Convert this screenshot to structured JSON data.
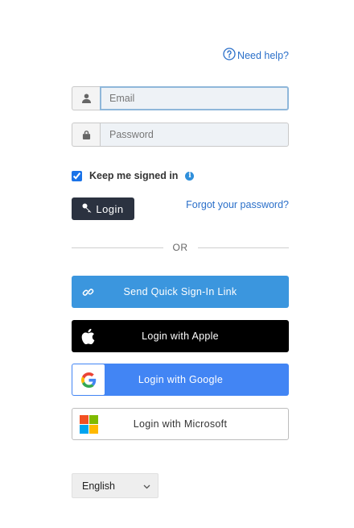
{
  "help": {
    "label": "Need help?",
    "icon": "help-circle-icon",
    "color": "#2a6fc9"
  },
  "email": {
    "value": "",
    "placeholder": "Email",
    "icon": "user-icon"
  },
  "password": {
    "value": "",
    "placeholder": "Password",
    "icon": "lock-icon"
  },
  "remember": {
    "label": "Keep me signed in",
    "checked": true,
    "info_icon": "info-icon",
    "info_glyph": "i"
  },
  "login": {
    "label": "Login",
    "icon": "key-icon",
    "color": "#2b3240"
  },
  "forgot": {
    "label": "Forgot your password?"
  },
  "divider": {
    "label": "OR"
  },
  "sso": {
    "quick_link": {
      "label": "Send Quick Sign-In Link",
      "icon": "link-icon",
      "color": "#3b96de"
    },
    "apple": {
      "label": "Login with Apple",
      "icon": "apple-logo-icon",
      "color": "#000000"
    },
    "google": {
      "label": "Login with Google",
      "icon": "google-logo-icon",
      "color": "#4285f4"
    },
    "microsoft": {
      "label": "Login with Microsoft",
      "icon": "microsoft-logo-icon",
      "color": "#ffffff"
    }
  },
  "language": {
    "selected": "English",
    "icon": "chevron-down-icon"
  }
}
